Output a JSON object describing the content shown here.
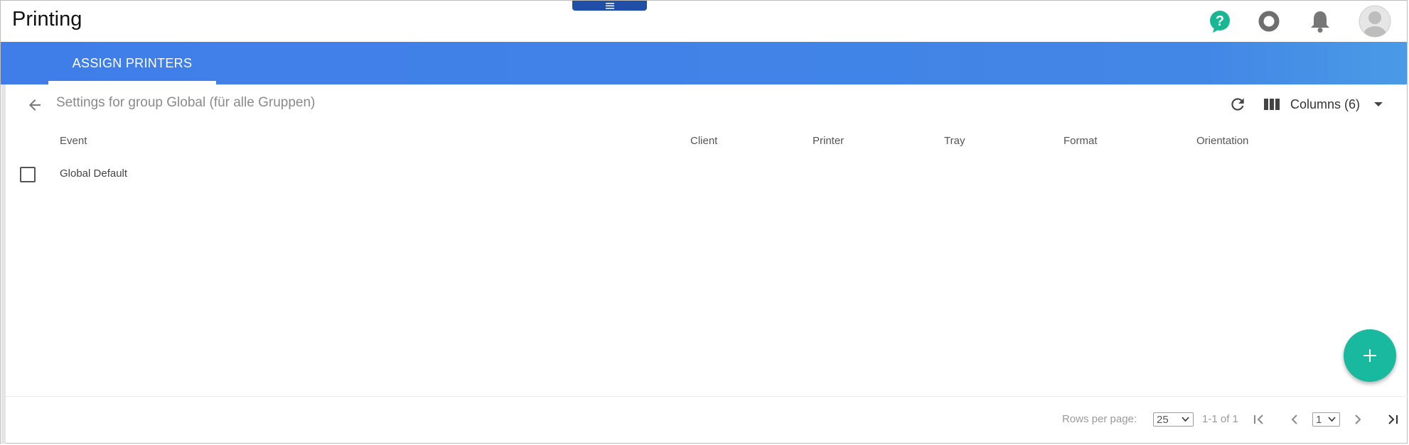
{
  "header": {
    "title": "Printing",
    "icons": [
      "menu-icon",
      "help-icon",
      "status-circle-icon",
      "bell-icon",
      "user-avatar-icon"
    ]
  },
  "nav": {
    "tabs": [
      {
        "label": "ASSIGN PRINTERS",
        "active": true
      }
    ]
  },
  "toolbar": {
    "subtitle": "Settings for group Global (für alle Gruppen)",
    "columns_label": "Columns (6)"
  },
  "table": {
    "columns": [
      "Event",
      "Client",
      "Printer",
      "Tray",
      "Format",
      "Orientation"
    ],
    "rows": [
      {
        "event": "Global Default",
        "client": "",
        "printer": "",
        "tray": "",
        "format": "",
        "orientation": ""
      }
    ]
  },
  "pagination": {
    "rows_per_page_label": "Rows per page:",
    "rows_per_page_value": "25",
    "range_text": "1-1 of 1",
    "page_value": "1"
  },
  "colors": {
    "nav_blue": "#4286e6",
    "fab_teal": "#18b99e",
    "help_teal": "#17b793",
    "menu_tab_blue": "#1f4fa6"
  }
}
